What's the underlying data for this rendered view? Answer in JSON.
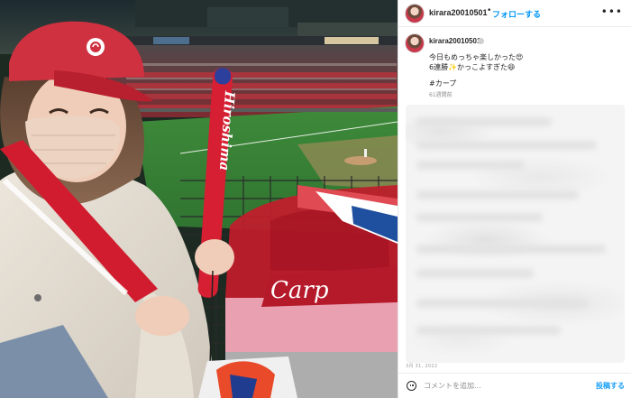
{
  "header": {
    "username": "kirara20010501",
    "separator": "•",
    "follow_label": "フォローする",
    "more_icon": "more-horizontal-icon"
  },
  "caption": {
    "username": "kirara20010501",
    "line1": "今日もめっちゃ楽しかった😍",
    "line2": "6連勝✨かっこよすぎた😆",
    "hashtag": "#カープ",
    "time_ago": "61週間前"
  },
  "photo": {
    "bat_text": "Hiroshima",
    "banner_text": "Carp",
    "alt_icon": "stadium-photo"
  },
  "post_date": "3月 31, 2022",
  "comment_bar": {
    "placeholder": "コメントを追加...",
    "post_label": "投稿する",
    "emoji_icon": "smile-icon"
  },
  "colors": {
    "carp_red": "#c7102e",
    "follow_blue": "#0095f6",
    "field_green": "#3f8f3c"
  }
}
